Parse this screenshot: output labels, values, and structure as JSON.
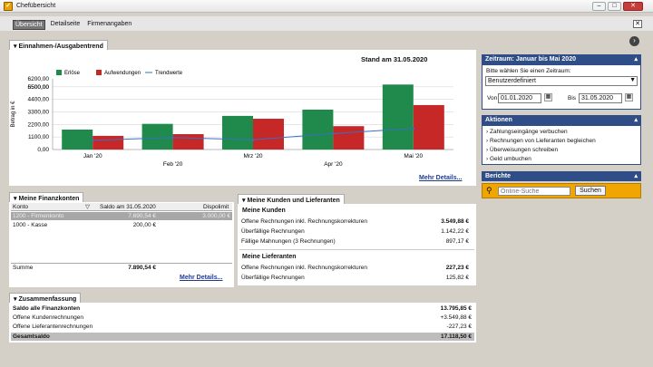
{
  "window": {
    "title": "Chefübersicht",
    "minimize": "–",
    "maximize": "□",
    "close": "✕"
  },
  "tabs": [
    "Übersicht",
    "Detailseite",
    "Firmenangaben"
  ],
  "trend": {
    "tab_label": "Einnahmen-/Ausgabentrend",
    "stand": "Stand am 31.05.2020",
    "more": "Mehr Details..."
  },
  "chart_data": {
    "type": "bar",
    "ylabel": "Betrag in €",
    "ticks": [
      "0,00",
      "1100,00",
      "2200,00",
      "3300,00",
      "4400,00",
      "5500,00",
      "6500,00",
      "6200,00"
    ],
    "ylim": [
      0,
      6200
    ],
    "categories": [
      "Jan '20",
      "Feb '20",
      "Mrz '20",
      "Apr '20",
      "Mai '20"
    ],
    "series": [
      {
        "name": "Erlöse",
        "color": "#1f8a4c",
        "values": [
          1750,
          2250,
          2950,
          3500,
          5700
        ]
      },
      {
        "name": "Aufwendungen",
        "color": "#c62828",
        "values": [
          1200,
          1350,
          2700,
          2050,
          3900
        ]
      },
      {
        "name": "Trendwerte",
        "color": "#3a6fc4",
        "values": [
          800,
          1050,
          850,
          1400,
          1850
        ]
      }
    ],
    "grid": true,
    "legend": "top-left"
  },
  "finanz": {
    "tab_label": "Meine Finanzkonten",
    "cols": [
      "Konto",
      "Saldo am 31.05.2020",
      "Dispolimit"
    ],
    "rows": [
      {
        "konto": "1200 - Firmenkonto",
        "saldo": "7.690,54 €",
        "dispo": "3.000,00 €",
        "selected": true
      },
      {
        "konto": "1000 - Kasse",
        "saldo": "200,00 €",
        "dispo": "",
        "selected": false
      }
    ],
    "summe_label": "Summe",
    "summe": "7.890,54 €",
    "more": "Mehr Details..."
  },
  "kunden": {
    "tab_label": "Meine Kunden und Lieferanten",
    "kunden_title": "Meine Kunden",
    "kunden_rows": [
      {
        "label": "Offene Rechnungen inkl. Rechnungskorrekturen",
        "value": "3.549,88 €",
        "bold": true
      },
      {
        "label": "Überfällige Rechnungen",
        "value": "1.142,22 €",
        "bold": false
      },
      {
        "label": "Fällige Mahnungen (3 Rechnungen)",
        "value": "897,17 €",
        "bold": false
      }
    ],
    "lieferanten_title": "Meine Lieferanten",
    "lieferanten_rows": [
      {
        "label": "Offene Rechnungen inkl. Rechnungskorrekturen",
        "value": "227,23 €",
        "bold": true
      },
      {
        "label": "Überfällige Rechnungen",
        "value": "125,82 €",
        "bold": false
      }
    ]
  },
  "summary": {
    "tab_label": "Zusammenfassung",
    "rows": [
      {
        "label": "Saldo alle Finanzkonten",
        "value": "13.795,85 €"
      },
      {
        "label": "Offene Kundenrechnungen",
        "value": "+3.549,88 €"
      },
      {
        "label": "Offene Lieferantenrechnungen",
        "value": "-227,23 €"
      }
    ],
    "total_label": "Gesamtsaldo",
    "total": "17.118,50 €"
  },
  "zeitraum": {
    "header": "Zeitraum: Januar bis Mai 2020",
    "prompt": "Bitte wählen Sie einen Zeitraum:",
    "select": "Benutzerdefiniert",
    "von_label": "Von",
    "von": "01.01.2020",
    "bis_label": "Bis",
    "bis": "31.05.2020"
  },
  "aktionen": {
    "header": "Aktionen",
    "items": [
      "Zahlungseingänge verbuchen",
      "Rechnungen von Lieferanten begleichen",
      "Überweisungen schreiben",
      "Geld umbuchen"
    ]
  },
  "berichte": {
    "header": "Berichte",
    "placeholder": "Online-Suche",
    "button": "Suchen"
  }
}
